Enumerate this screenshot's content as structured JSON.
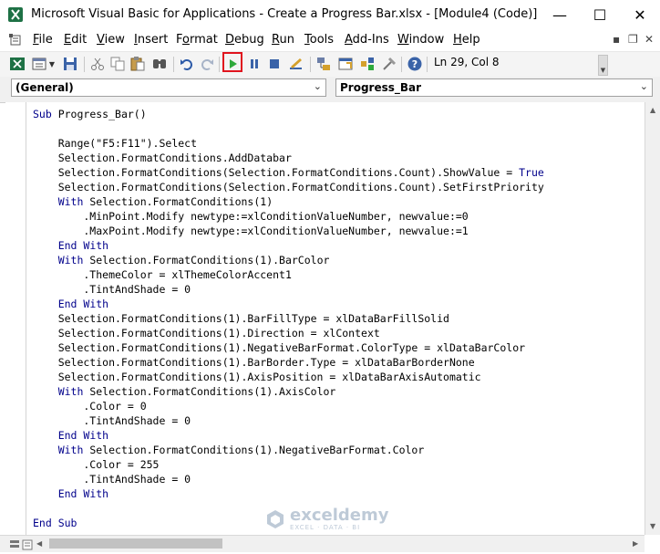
{
  "window": {
    "title": "Microsoft Visual Basic for Applications - Create a Progress Bar.xlsx - [Module4 (Code)]",
    "minimize": "—",
    "maximize": "☐",
    "close": "✕"
  },
  "menu": {
    "items": [
      {
        "ul": "F",
        "rest": "ile"
      },
      {
        "ul": "E",
        "rest": "dit"
      },
      {
        "ul": "V",
        "rest": "iew"
      },
      {
        "ul": "I",
        "rest": "nsert"
      },
      {
        "pre": "F",
        "ul": "o",
        "rest": "rmat"
      },
      {
        "ul": "D",
        "rest": "ebug"
      },
      {
        "ul": "R",
        "rest": "un"
      },
      {
        "ul": "T",
        "rest": "ools"
      },
      {
        "ul": "A",
        "rest": "dd-Ins"
      },
      {
        "ul": "W",
        "rest": "indow"
      },
      {
        "ul": "H",
        "rest": "elp"
      }
    ],
    "restore": "▪",
    "maximize": "❐",
    "close": "✕"
  },
  "toolbar": {
    "status": "Ln 29, Col 8",
    "colors": {
      "run": "#2eaa3c",
      "highlight": "#e0141e"
    }
  },
  "combos": {
    "object": "(General)",
    "procedure": "Progress_Bar"
  },
  "code": {
    "lines": [
      [
        {
          "t": "Sub",
          "k": 1
        },
        {
          "t": " Progress_Bar()"
        }
      ],
      [],
      [
        {
          "t": "    Range(\"F5:F11\").Select"
        }
      ],
      [
        {
          "t": "    Selection.FormatConditions.AddDatabar"
        }
      ],
      [
        {
          "t": "    Selection.FormatConditions(Selection.FormatConditions.Count).ShowValue = "
        },
        {
          "t": "True",
          "k": 1
        }
      ],
      [
        {
          "t": "    Selection.FormatConditions(Selection.FormatConditions.Count).SetFirstPriority"
        }
      ],
      [
        {
          "t": "    "
        },
        {
          "t": "With",
          "k": 1
        },
        {
          "t": " Selection.FormatConditions(1)"
        }
      ],
      [
        {
          "t": "        .MinPoint.Modify newtype:=xlConditionValueNumber, newvalue:=0"
        }
      ],
      [
        {
          "t": "        .MaxPoint.Modify newtype:=xlConditionValueNumber, newvalue:=1"
        }
      ],
      [
        {
          "t": "    "
        },
        {
          "t": "End With",
          "k": 1
        }
      ],
      [
        {
          "t": "    "
        },
        {
          "t": "With",
          "k": 1
        },
        {
          "t": " Selection.FormatConditions(1).BarColor"
        }
      ],
      [
        {
          "t": "        .ThemeColor = xlThemeColorAccent1"
        }
      ],
      [
        {
          "t": "        .TintAndShade = 0"
        }
      ],
      [
        {
          "t": "    "
        },
        {
          "t": "End With",
          "k": 1
        }
      ],
      [
        {
          "t": "    Selection.FormatConditions(1).BarFillType = xlDataBarFillSolid"
        }
      ],
      [
        {
          "t": "    Selection.FormatConditions(1).Direction = xlContext"
        }
      ],
      [
        {
          "t": "    Selection.FormatConditions(1).NegativeBarFormat.ColorType = xlDataBarColor"
        }
      ],
      [
        {
          "t": "    Selection.FormatConditions(1).BarBorder.Type = xlDataBarBorderNone"
        }
      ],
      [
        {
          "t": "    Selection.FormatConditions(1).AxisPosition = xlDataBarAxisAutomatic"
        }
      ],
      [
        {
          "t": "    "
        },
        {
          "t": "With",
          "k": 1
        },
        {
          "t": " Selection.FormatConditions(1).AxisColor"
        }
      ],
      [
        {
          "t": "        .Color = 0"
        }
      ],
      [
        {
          "t": "        .TintAndShade = 0"
        }
      ],
      [
        {
          "t": "    "
        },
        {
          "t": "End With",
          "k": 1
        }
      ],
      [
        {
          "t": "    "
        },
        {
          "t": "With",
          "k": 1
        },
        {
          "t": " Selection.FormatConditions(1).NegativeBarFormat.Color"
        }
      ],
      [
        {
          "t": "        .Color = 255"
        }
      ],
      [
        {
          "t": "        .TintAndShade = 0"
        }
      ],
      [
        {
          "t": "    "
        },
        {
          "t": "End With",
          "k": 1
        }
      ],
      [],
      [
        {
          "t": "End Sub",
          "k": 1
        }
      ]
    ]
  },
  "watermark": {
    "name": "exceldemy",
    "tagline": "EXCEL · DATA · BI"
  }
}
